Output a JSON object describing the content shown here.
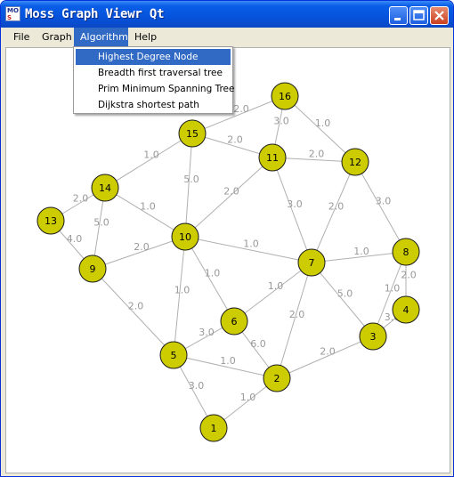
{
  "window": {
    "title": "Moss Graph Viewr Qt",
    "icon": "moss-app-icon"
  },
  "menubar": {
    "items": [
      "File",
      "Graph",
      "Algorithm",
      "Help"
    ],
    "active": "Algorithm"
  },
  "algorithm_menu": {
    "items": [
      "Highest Degree Node",
      "Breadth first traversal tree",
      "Prim Minimum Spanning Tree",
      "Dijkstra shortest path"
    ],
    "highlighted": "Highest Degree Node"
  },
  "graph": {
    "node_color": "#cccc00",
    "edge_color": "#b0b0b0",
    "nodes": [
      "1",
      "2",
      "3",
      "4",
      "5",
      "6",
      "7",
      "8",
      "9",
      "10",
      "11",
      "12",
      "13",
      "14",
      "15",
      "16"
    ],
    "edges": [
      {
        "from": "1",
        "to": "5",
        "weight": "3.0"
      },
      {
        "from": "1",
        "to": "2",
        "weight": "1.0"
      },
      {
        "from": "5",
        "to": "2",
        "weight": "1.0"
      },
      {
        "from": "5",
        "to": "6",
        "weight": "3.0"
      },
      {
        "from": "6",
        "to": "2",
        "weight": "6.0"
      },
      {
        "from": "5",
        "to": "10",
        "weight": "1.0"
      },
      {
        "from": "5",
        "to": "9",
        "weight": "2.0"
      },
      {
        "from": "2",
        "to": "7",
        "weight": "2.0"
      },
      {
        "from": "2",
        "to": "3",
        "weight": "2.0"
      },
      {
        "from": "3",
        "to": "7",
        "weight": "5.0"
      },
      {
        "from": "3",
        "to": "4",
        "weight": "3.0"
      },
      {
        "from": "3",
        "to": "8",
        "weight": "1.0"
      },
      {
        "from": "8",
        "to": "4",
        "weight": "2.0"
      },
      {
        "from": "8",
        "to": "7",
        "weight": "1.0"
      },
      {
        "from": "8",
        "to": "12",
        "weight": "3.0"
      },
      {
        "from": "6",
        "to": "7",
        "weight": "1.0"
      },
      {
        "from": "6",
        "to": "10",
        "weight": "1.0"
      },
      {
        "from": "10",
        "to": "7",
        "weight": "1.0"
      },
      {
        "from": "10",
        "to": "9",
        "weight": "2.0"
      },
      {
        "from": "10",
        "to": "14",
        "weight": "1.0"
      },
      {
        "from": "10",
        "to": "15",
        "weight": "5.0"
      },
      {
        "from": "10",
        "to": "11",
        "weight": "2.0"
      },
      {
        "from": "7",
        "to": "11",
        "weight": "3.0"
      },
      {
        "from": "7",
        "to": "12",
        "weight": "2.0"
      },
      {
        "from": "11",
        "to": "12",
        "weight": "2.0"
      },
      {
        "from": "11",
        "to": "15",
        "weight": "2.0"
      },
      {
        "from": "11",
        "to": "16",
        "weight": "3.0"
      },
      {
        "from": "12",
        "to": "16",
        "weight": "1.0"
      },
      {
        "from": "15",
        "to": "16",
        "weight": "2.0"
      },
      {
        "from": "15",
        "to": "14",
        "weight": "1.0"
      },
      {
        "from": "14",
        "to": "13",
        "weight": "2.0"
      },
      {
        "from": "14",
        "to": "9",
        "weight": "5.0"
      },
      {
        "from": "13",
        "to": "9",
        "weight": "4.0"
      }
    ]
  }
}
